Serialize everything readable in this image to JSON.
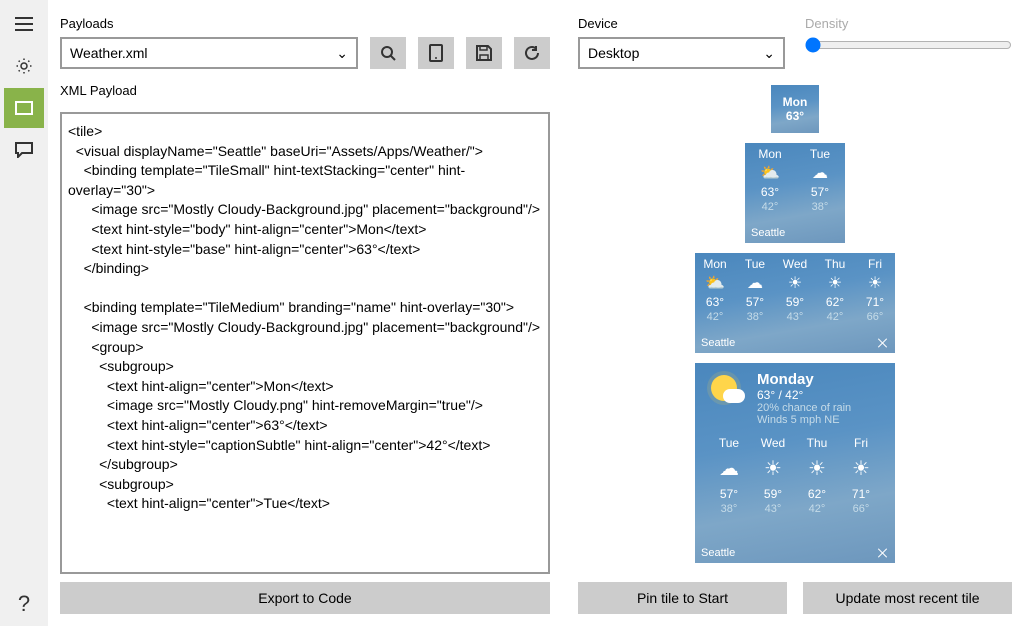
{
  "labels": {
    "payloads": "Payloads",
    "xml_payload": "XML Payload",
    "device": "Device",
    "density": "Density"
  },
  "payload_select": "Weather.xml",
  "device_select": "Desktop",
  "buttons": {
    "export": "Export to Code",
    "pin": "Pin tile to Start",
    "update": "Update most recent tile"
  },
  "xml": "<tile>\n  <visual displayName=\"Seattle\" baseUri=\"Assets/Apps/Weather/\">\n    <binding template=\"TileSmall\" hint-textStacking=\"center\" hint-overlay=\"30\">\n      <image src=\"Mostly Cloudy-Background.jpg\" placement=\"background\"/>\n      <text hint-style=\"body\" hint-align=\"center\">Mon</text>\n      <text hint-style=\"base\" hint-align=\"center\">63°</text>\n    </binding>\n\n    <binding template=\"TileMedium\" branding=\"name\" hint-overlay=\"30\">\n      <image src=\"Mostly Cloudy-Background.jpg\" placement=\"background\"/>\n      <group>\n        <subgroup>\n          <text hint-align=\"center\">Mon</text>\n          <image src=\"Mostly Cloudy.png\" hint-removeMargin=\"true\"/>\n          <text hint-align=\"center\">63°</text>\n          <text hint-style=\"captionSubtle\" hint-align=\"center\">42°</text>\n        </subgroup>\n        <subgroup>\n          <text hint-align=\"center\">Tue</text>",
  "brand_city": "Seattle",
  "large": {
    "day": "Monday",
    "hi_lo": "63° / 42°",
    "chance": "20% chance of rain",
    "wind": "Winds 5 mph NE"
  },
  "small": {
    "day": "Mon",
    "temp": "63°"
  },
  "days": [
    {
      "d": "Mon",
      "hi": "63°",
      "lo": "42°",
      "ic": "⛅"
    },
    {
      "d": "Tue",
      "hi": "57°",
      "lo": "38°",
      "ic": "☁"
    },
    {
      "d": "Wed",
      "hi": "59°",
      "lo": "43°",
      "ic": "☀"
    },
    {
      "d": "Thu",
      "hi": "62°",
      "lo": "42°",
      "ic": "☀"
    },
    {
      "d": "Fri",
      "hi": "71°",
      "lo": "66°",
      "ic": "☀"
    }
  ]
}
